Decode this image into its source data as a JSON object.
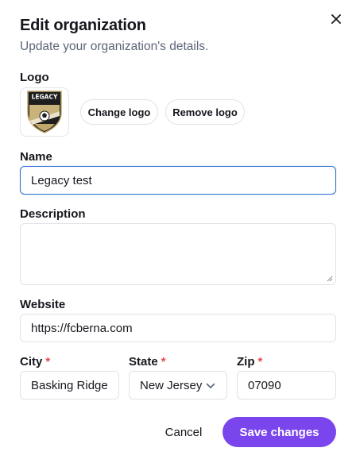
{
  "dialog": {
    "title": "Edit organization",
    "subtitle": "Update your organization's details."
  },
  "logo": {
    "label": "Logo",
    "image_text": "LEGACY",
    "change_label": "Change logo",
    "remove_label": "Remove logo"
  },
  "name": {
    "label": "Name",
    "value": "Legacy test"
  },
  "description": {
    "label": "Description",
    "value": ""
  },
  "website": {
    "label": "Website",
    "value": "https://fcberna.com"
  },
  "city": {
    "label": "City",
    "required_mark": "*",
    "value": "Basking Ridge"
  },
  "state": {
    "label": "State",
    "required_mark": "*",
    "value": "New Jersey"
  },
  "zip": {
    "label": "Zip",
    "required_mark": "*",
    "value": "07090"
  },
  "actions": {
    "cancel_label": "Cancel",
    "save_label": "Save changes"
  },
  "colors": {
    "primary": "#7b45ee",
    "focus_border": "#2f6fd6",
    "required": "#e5484d",
    "muted_text": "#5b6478"
  }
}
